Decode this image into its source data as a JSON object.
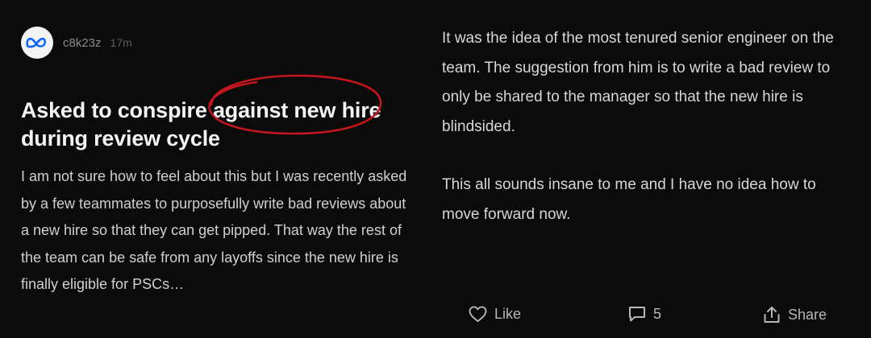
{
  "post": {
    "author": "c8k23z",
    "time": "17m",
    "title": "Asked to conspire against new hire during review cycle",
    "excerpt": "I am not sure how to feel about this but I was recently asked by a few teammates to purposefully write bad reviews about a new hire so that they can get pipped. That way the rest of the team can be safe from any layoffs since the new hire is finally eligible for PSCs…",
    "avatar_icon": "meta-logo-icon",
    "annotation_color": "#c4161c"
  },
  "body": {
    "paragraphs": [
      "It was the idea of the most tenured senior engineer on the team. The suggestion from him is to write a bad review to only be shared to the manager so that the new hire is blindsided.",
      "This all sounds insane to me and I have no idea how to move forward now."
    ]
  },
  "actions": {
    "like_label": "Like",
    "like_icon": "heart-icon",
    "comment_count": "5",
    "comment_icon": "comment-icon",
    "share_label": "Share",
    "share_icon": "share-icon"
  }
}
